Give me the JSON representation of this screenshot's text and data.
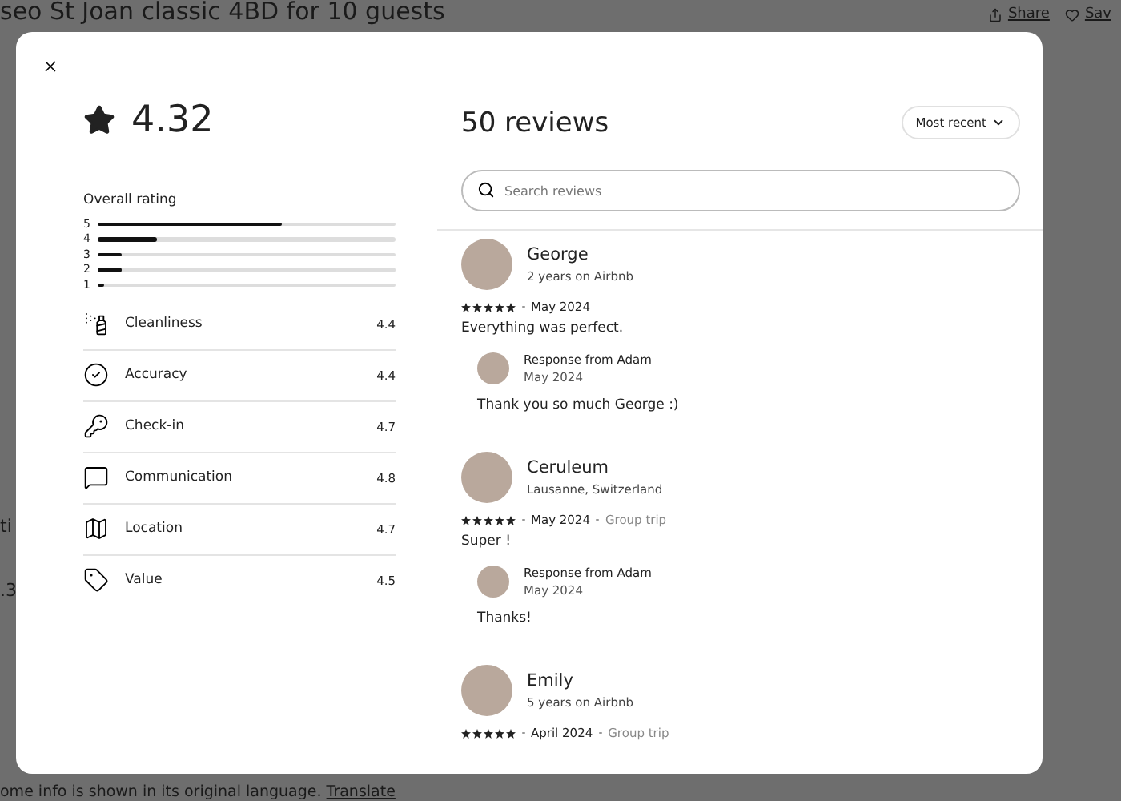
{
  "background": {
    "title": "seo St Joan classic 4BD for 10 guests",
    "actions": [
      {
        "kind": "share",
        "label": "Share"
      },
      {
        "kind": "save",
        "label": "Sav"
      }
    ],
    "side_fragments": [
      "ti",
      ".3"
    ],
    "footer": {
      "text": "ome info is shown in its original language.",
      "link": "Translate"
    }
  },
  "modal": {
    "rating": "4.32",
    "overall": {
      "title": "Overall rating",
      "bars": [
        {
          "label": "5",
          "level": 0.62
        },
        {
          "label": "4",
          "level": 0.2
        },
        {
          "label": "3",
          "level": 0.08
        },
        {
          "label": "2",
          "level": 0.08
        },
        {
          "label": "1",
          "level": 0.02
        }
      ]
    },
    "categories": [
      {
        "kind": "cleanliness",
        "label": "Cleanliness",
        "score": "4.4"
      },
      {
        "kind": "accuracy",
        "label": "Accuracy",
        "score": "4.4"
      },
      {
        "kind": "checkin",
        "label": "Check-in",
        "score": "4.7"
      },
      {
        "kind": "communication",
        "label": "Communication",
        "score": "4.8"
      },
      {
        "kind": "location",
        "label": "Location",
        "score": "4.7"
      },
      {
        "kind": "value",
        "label": "Value",
        "score": "4.5"
      }
    ],
    "reviews_title": "50 reviews",
    "sort": "Most recent",
    "search": {
      "placeholder": "Search reviews"
    },
    "reviews": [
      {
        "name": "George",
        "meta": "2 years on Airbnb",
        "stars": 5,
        "date": "May 2024",
        "text": "Everything was perfect.",
        "response": {
          "title": "Response from Adam",
          "date": "May 2024",
          "text": "Thank you so much George :)"
        }
      },
      {
        "name": "Ceruleum",
        "meta": "Lausanne, Switzerland",
        "stars": 5,
        "date": "May 2024",
        "trip": "Group trip",
        "text": "Super !",
        "response": {
          "title": "Response from Adam",
          "date": "May 2024",
          "text": "Thanks!"
        }
      },
      {
        "name": "Emily",
        "meta": "5 years on Airbnb",
        "stars": 5,
        "date": "April 2024",
        "trip": "Group trip"
      }
    ]
  }
}
